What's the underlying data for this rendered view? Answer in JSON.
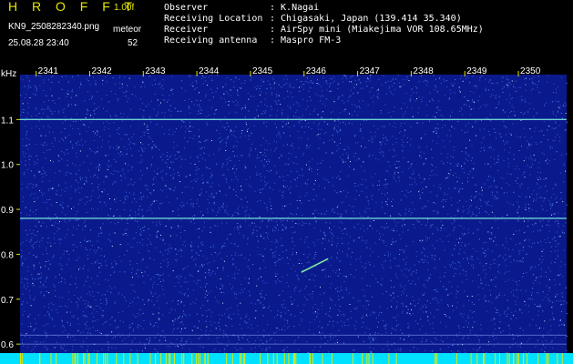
{
  "header": {
    "app_title": "H R O F F T",
    "version": "1.00f",
    "filename": "KN9_2508282340.png",
    "datetime": "25.08.28 23:40",
    "meteor_label": "meteor",
    "meteor_count": "52"
  },
  "info": [
    {
      "key": "Observer",
      "value": ": K.Nagai"
    },
    {
      "key": "Receiving Location",
      "value": ": Chigasaki, Japan (139.414 35.340)"
    },
    {
      "key": "Receiver",
      "value": ": AirSpy mini (Miakejima VOR 108.65MHz)"
    },
    {
      "key": "Receiving antenna",
      "value": ": Maspro FM-3"
    }
  ],
  "colors": {
    "background": "#0a1a8c",
    "noise": "#5a8cff",
    "signal": "#7ff0e0",
    "bottom_bar": "#00e0ff",
    "tick": "#e6e600"
  },
  "chart_data": {
    "type": "heatmap",
    "ylabel": "kHz",
    "x_ticks": [
      "2341",
      "2342",
      "2343",
      "2344",
      "2345",
      "2346",
      "2347",
      "2348",
      "2349",
      "2350"
    ],
    "y_ticks": [
      "1.1",
      "1.0",
      "0.9",
      "0.8",
      "0.7",
      "0.6"
    ],
    "xlim": [
      2340.7,
      2350.9
    ],
    "ylim": [
      0.58,
      1.2
    ],
    "carriers": [
      {
        "y": 1.1
      },
      {
        "y": 0.88
      },
      {
        "y": 0.62
      },
      {
        "y": 0.6
      }
    ],
    "meteor_echo": {
      "x_start": 2345.95,
      "x_end": 2346.45,
      "y_start": 0.76,
      "y_end": 0.79
    }
  }
}
